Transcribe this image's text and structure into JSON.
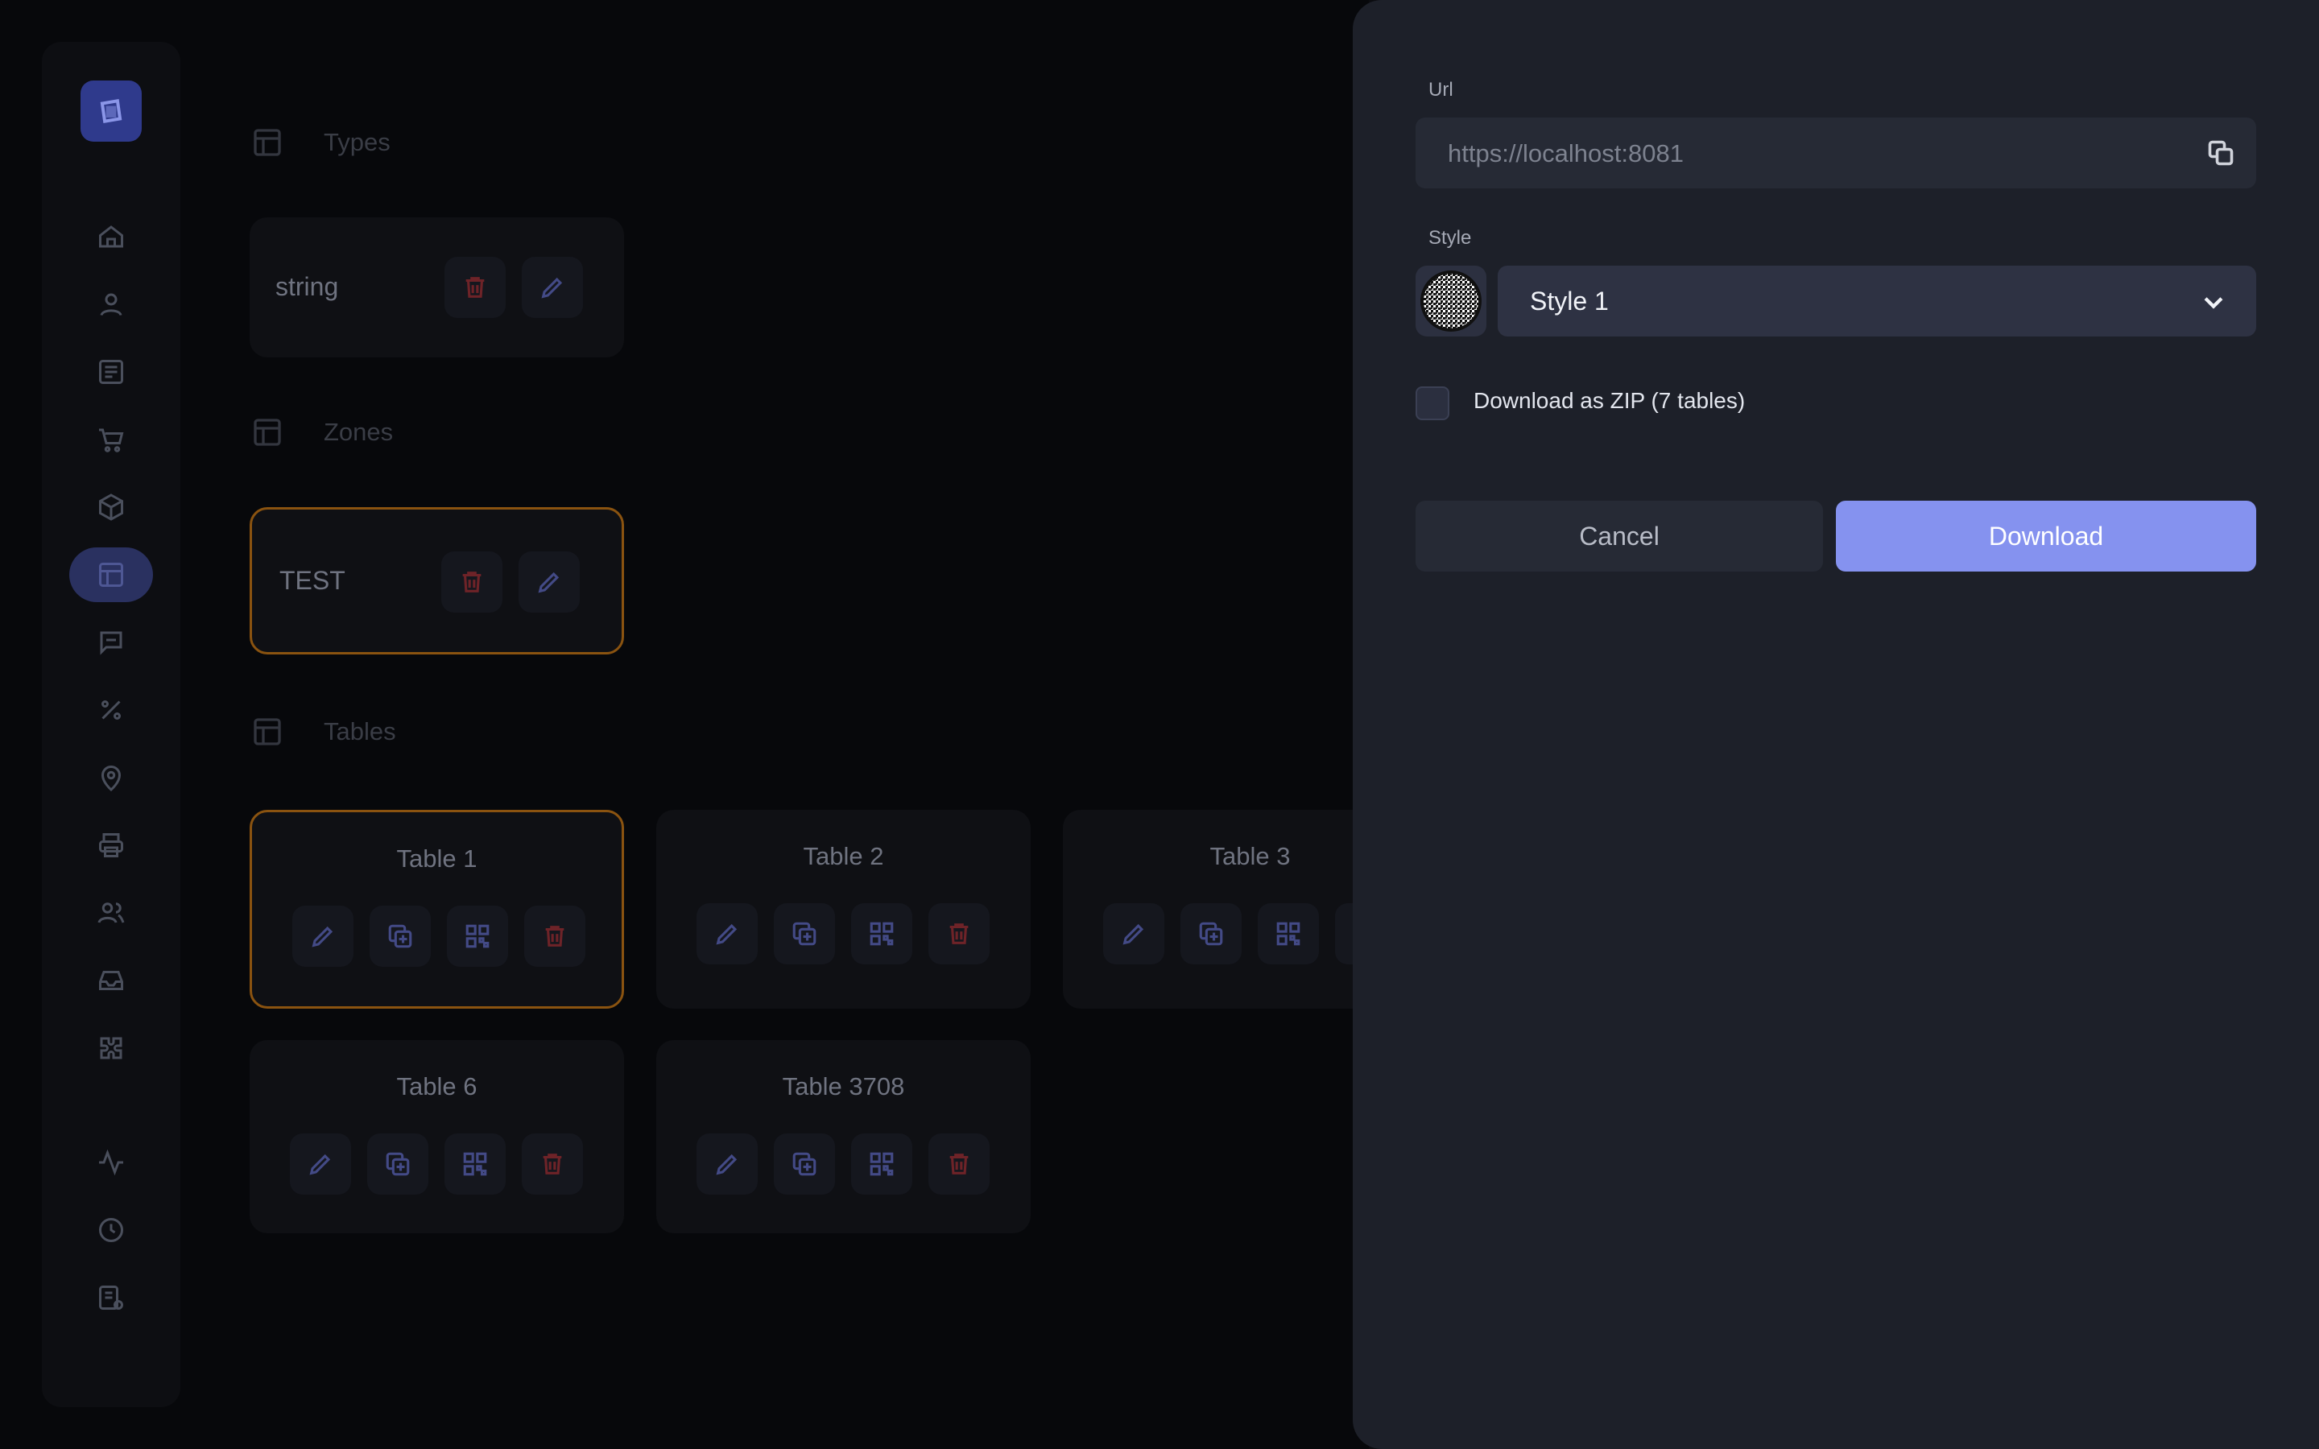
{
  "sections": {
    "types": "Types",
    "zones": "Zones",
    "tables": "Tables"
  },
  "types_cards": [
    {
      "name": "string"
    }
  ],
  "zones_cards": [
    {
      "name": "TEST"
    }
  ],
  "table_cards": [
    {
      "name": "Table 1"
    },
    {
      "name": "Table 2"
    },
    {
      "name": "Table 3"
    },
    {
      "name": "Table 6"
    },
    {
      "name": "Table 3708"
    }
  ],
  "sidebar": {
    "items": [
      "home-icon",
      "user-icon",
      "menu-list-icon",
      "cart-icon",
      "box-icon",
      "tables-icon",
      "chat-icon",
      "percent-icon",
      "location-icon",
      "printer-icon",
      "users-icon",
      "inbox-icon",
      "puzzle-icon",
      "activity-icon",
      "clock-icon",
      "report-icon"
    ]
  },
  "drawer": {
    "url_label": "Url",
    "url_placeholder": "https://localhost:8081",
    "style_label": "Style",
    "style_value": "Style 1",
    "zip_label": "Download as ZIP (7 tables)",
    "cancel_label": "Cancel",
    "download_label": "Download"
  },
  "colors": {
    "accent": "#8592ef",
    "drawer_bg": "#1d2029",
    "selected_border": "#8a5310",
    "delete_red": "#6e2328"
  }
}
